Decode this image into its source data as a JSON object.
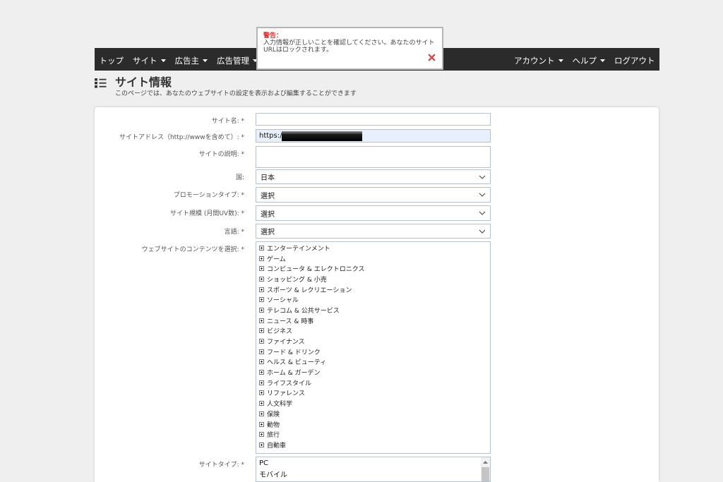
{
  "theme": {
    "navbar_background": "#2b2b2b",
    "alert_title_color": "#e03131",
    "alert_close_color": "#e8423f",
    "autofill_background": "#e8f0fe",
    "page_background": "#efefef"
  },
  "nav": {
    "left": [
      {
        "label": "トップ"
      },
      {
        "label": "サイト",
        "icon": "caret-down-icon"
      },
      {
        "label": "広告主",
        "icon": "caret-down-icon"
      },
      {
        "label": "広告管理",
        "icon": "caret-down-icon"
      }
    ],
    "right": [
      {
        "label": "アカウント",
        "icon": "caret-down-icon"
      },
      {
        "label": "ヘルプ",
        "icon": "caret-down-icon"
      },
      {
        "label": "ログアウト"
      }
    ]
  },
  "alert": {
    "title": "警告：",
    "message": "入力情報が正しいことを確認してください。あなたのサイトURLはロックされます。",
    "close_icon": "close-x-icon"
  },
  "page": {
    "icon": "list-view-icon",
    "title": "サイト情報",
    "subtitle": "このページでは、あなたのウェブサイトの設定を表示および編集することができます"
  },
  "form": {
    "site_name": {
      "label": "サイト名: *",
      "value": ""
    },
    "site_url": {
      "label": "サイトアドレス（http://wwwを含めて）: *",
      "value": "https://"
    },
    "site_description": {
      "label": "サイトの説明: *",
      "value": ""
    },
    "country": {
      "label": "国:",
      "selected": "日本",
      "icon": "chevron-down-icon"
    },
    "promotion_type": {
      "label": "プロモーションタイプ: *",
      "selected": "選択",
      "icon": "chevron-down-icon"
    },
    "site_scale": {
      "label": "サイト規模 (月間UV数): *",
      "selected": "選択",
      "icon": "chevron-down-icon"
    },
    "language": {
      "label": "言語: *",
      "selected": "選択",
      "icon": "chevron-down-icon"
    },
    "content_categories": {
      "label": "ウェブサイトのコンテンツを選択: *",
      "expand_icon": "expand-plus-icon",
      "items": [
        "エンターテインメント",
        "ゲーム",
        "コンピュータ & エレクトロニクス",
        "ショッピング & 小売",
        "スポーツ & レクリエーション",
        "ソーシャル",
        "テレコム & 公共サービス",
        "ニュース & 時事",
        "ビジネス",
        "ファイナンス",
        "フード & ドリンク",
        "ヘルス & ビューティ",
        "ホーム & ガーデン",
        "ライフスタイル",
        "リファレンス",
        "人文科学",
        "保険",
        "動物",
        "旅行",
        "自動車"
      ]
    },
    "site_type": {
      "label": "サイトタイプ: *",
      "options": [
        "PC",
        "モバイル"
      ],
      "scroll_icon": "scroll-up-arrow-icon"
    }
  }
}
